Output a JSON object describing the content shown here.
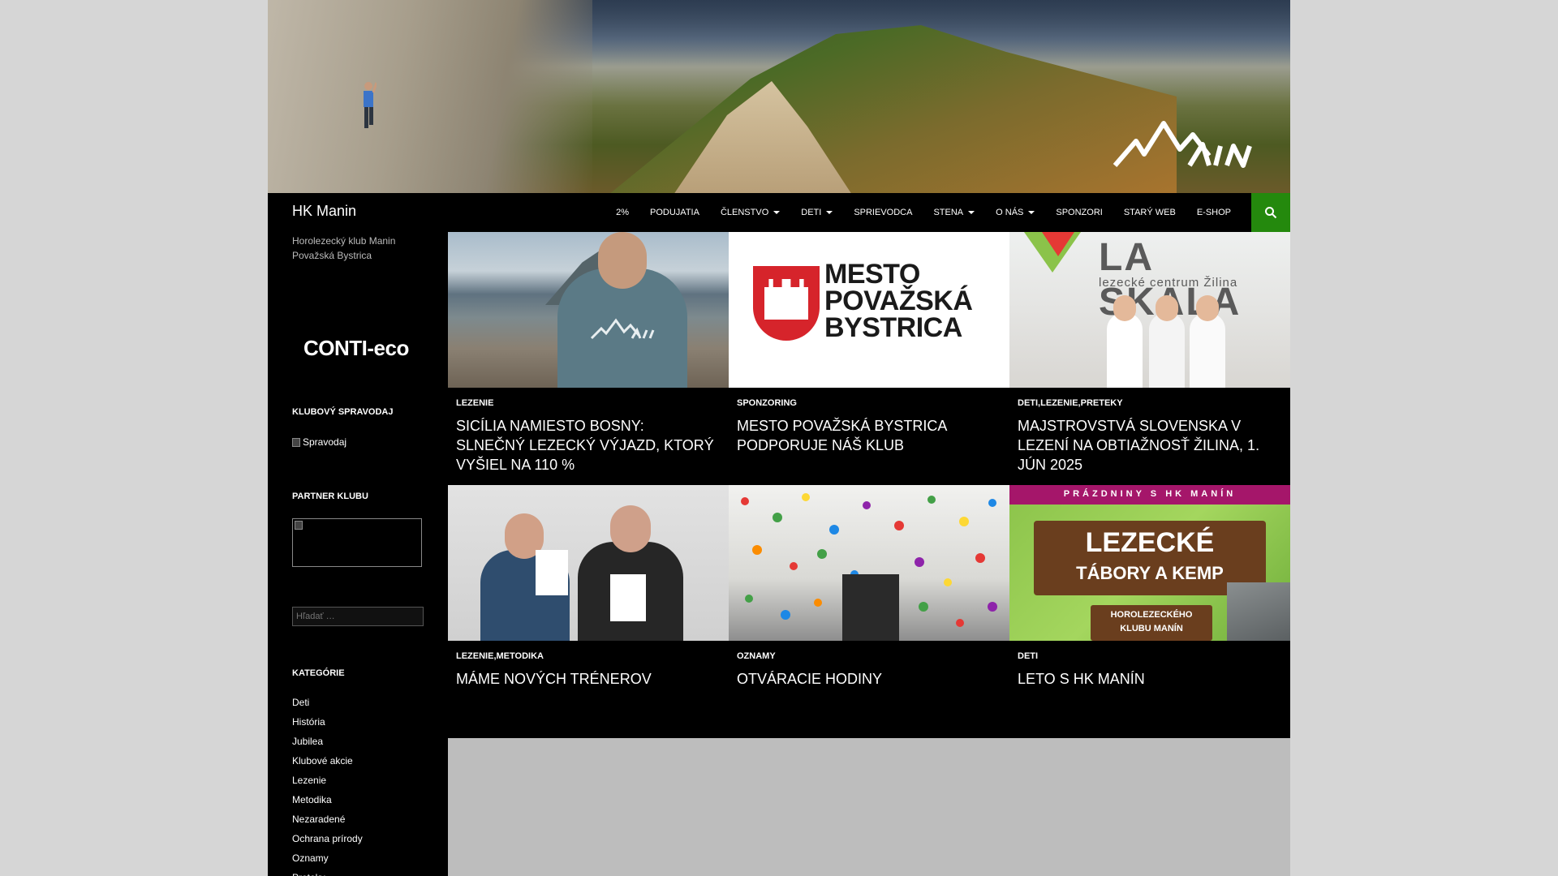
{
  "site": {
    "title": "HK Manin",
    "tagline": "Horolezecký klub Manin Považská Bystrica"
  },
  "nav": {
    "items": [
      {
        "label": "2%",
        "has_submenu": false
      },
      {
        "label": "PODUJATIA",
        "has_submenu": false
      },
      {
        "label": "ČLENSTVO",
        "has_submenu": true
      },
      {
        "label": "DETI",
        "has_submenu": true
      },
      {
        "label": "SPRIEVODCA",
        "has_submenu": false
      },
      {
        "label": "STENA",
        "has_submenu": true
      },
      {
        "label": "O NÁS",
        "has_submenu": true
      },
      {
        "label": "SPONZORI",
        "has_submenu": false
      },
      {
        "label": "STARÝ WEB",
        "has_submenu": false
      },
      {
        "label": "E-SHOP",
        "has_submenu": false
      }
    ],
    "search_icon": "search-icon",
    "accent_color": "#24890d"
  },
  "sidebar": {
    "sponsor_text": "CONTI-eco",
    "newsletter": {
      "title": "KLUBOVÝ SPRAVODAJ",
      "image_alt": "Spravodaj"
    },
    "partner": {
      "title": "PARTNER KLUBU"
    },
    "search": {
      "placeholder": "Hľadať …"
    },
    "categories": {
      "title": "KATEGÓRIE",
      "items": [
        "Deti",
        "História",
        "Jubilea",
        "Klubové akcie",
        "Lezenie",
        "Metodika",
        "Nezaradené",
        "Ochrana prírody",
        "Oznamy",
        "Preteky"
      ]
    }
  },
  "posts": [
    {
      "categories": "LEZENIE",
      "title": "SICÍLIA NAMIESTO BOSNY: SLNEČNÝ LEZECKÝ VÝJAZD, KTORÝ VYŠIEL NA 110 %"
    },
    {
      "categories": "SPONZORING",
      "title": "MESTO POVAŽSKÁ BYSTRICA PODPORUJE NÁŠ KLUB",
      "thumb_words": [
        "MESTO",
        "POVAŽSKÁ",
        "BYSTRICA"
      ]
    },
    {
      "categories": "DETI,LEZENIE,PRETEKY",
      "title": "MAJSTROVSTVÁ SLOVENSKA V LEZENÍ NA OBTIAŽNOSŤ ŽILINA, 1. JÚN 2025",
      "thumb_brand": "LA SKALA",
      "thumb_sub": "lezecké centrum Žilina"
    },
    {
      "categories": "LEZENIE,METODIKA",
      "title": "MÁME NOVÝCH TRÉNEROV"
    },
    {
      "categories": "OZNAMY",
      "title": "OTVÁRACIE HODINY"
    },
    {
      "categories": "DETI",
      "title": "LETO S HK MANÍN",
      "thumb_top": "PRÁZDNINY S HK MANÍN",
      "thumb_big1": "LEZECKÉ",
      "thumb_big2": "TÁBORY A KEMP",
      "thumb_small1": "HOROLEZECKÉHO",
      "thumb_small2": "KLUBU MANÍN"
    }
  ]
}
